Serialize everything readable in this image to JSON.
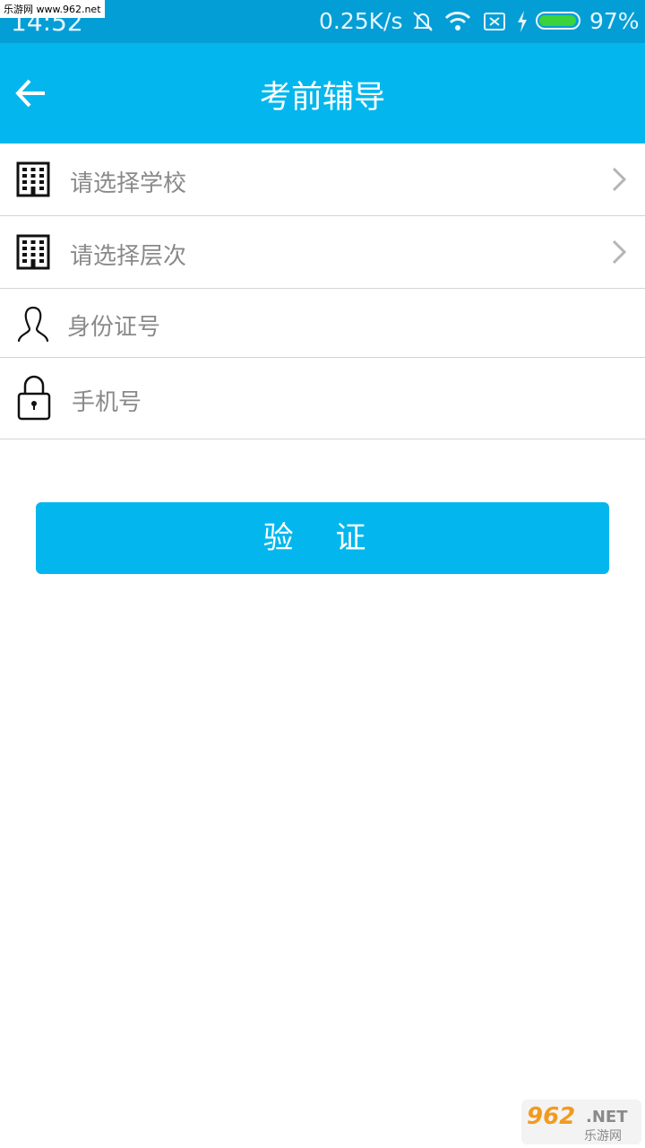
{
  "status_bar": {
    "time": "14:52",
    "net_speed": "0.25K/s",
    "battery": "97%",
    "battery_level": 0.97
  },
  "watermark": "乐游网 www.962.net",
  "header": {
    "title": "考前辅导"
  },
  "form": {
    "school_label": "请选择学校",
    "level_label": "请选择层次",
    "id_placeholder": "身份证号",
    "phone_placeholder": "手机号"
  },
  "verify_button": "验 证",
  "logo": {
    "main": "962.NET",
    "sub": "乐游网"
  }
}
